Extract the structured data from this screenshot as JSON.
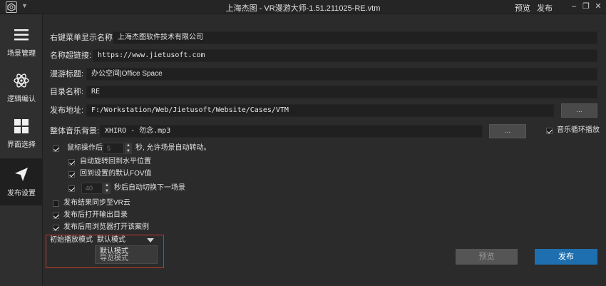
{
  "titlebar": {
    "title": "上海杰图 - VR漫游大师-1.51.211025-RE.vtm",
    "preview_link": "预览",
    "publish_link": "发布",
    "minimize": "–",
    "restore": "❐",
    "close": "✕"
  },
  "sidebar": {
    "items": [
      {
        "label": "场景管理",
        "icon": "menu-icon"
      },
      {
        "label": "逻辑编认",
        "icon": "atom-icon"
      },
      {
        "label": "界面选择",
        "icon": "grid-icon"
      },
      {
        "label": "发布设置",
        "icon": "send-arrow-icon"
      }
    ]
  },
  "form": {
    "context_menu_label": "右键菜单显示名称:",
    "context_menu_value": "上海杰图软件技术有限公司",
    "link_label": "名称超链接:",
    "link_value": "https://www.jietusoft.com",
    "tour_title_label": "漫游标题:",
    "tour_title_value": "办公空间|Office Space",
    "dir_name_label": "目录名称:",
    "dir_name_value": "RE",
    "publish_path_label": "发布地址:",
    "publish_path_value": "F:/Workstation/Web/Jietusoft/Website/Cases/VTM",
    "browse_label": "...",
    "music_label": "整体音乐背景:",
    "music_value": "XHIRO - 勿念.mp3",
    "music_browse_label": "...",
    "music_loop_label": "音乐循环播放"
  },
  "options": {
    "mouse_after_label": "鼠标操作后",
    "mouse_after_value": "5",
    "mouse_after_suffix": "秒, 允许场景自动转动。",
    "auto_rotate_label": "自动旋转回到水平位置",
    "default_fov_label": "回到设置的默认FOV值",
    "auto_switch_value": "40",
    "auto_switch_suffix": "秒后自动切换下一场景",
    "sync_cloud_label": "发布结果同步至VR云",
    "open_output_label": "发布后打开输出目录",
    "open_browser_label": "发布后用浏览器打开该案例",
    "play_mode_label": "初始播放模式",
    "play_mode_selected": "默认模式",
    "play_mode_options": [
      "默认模式",
      "导览模式"
    ]
  },
  "buttons": {
    "preview": "预览",
    "publish": "发布"
  },
  "colors": {
    "accent": "#1e6fb0",
    "highlight": "#c0392b"
  }
}
